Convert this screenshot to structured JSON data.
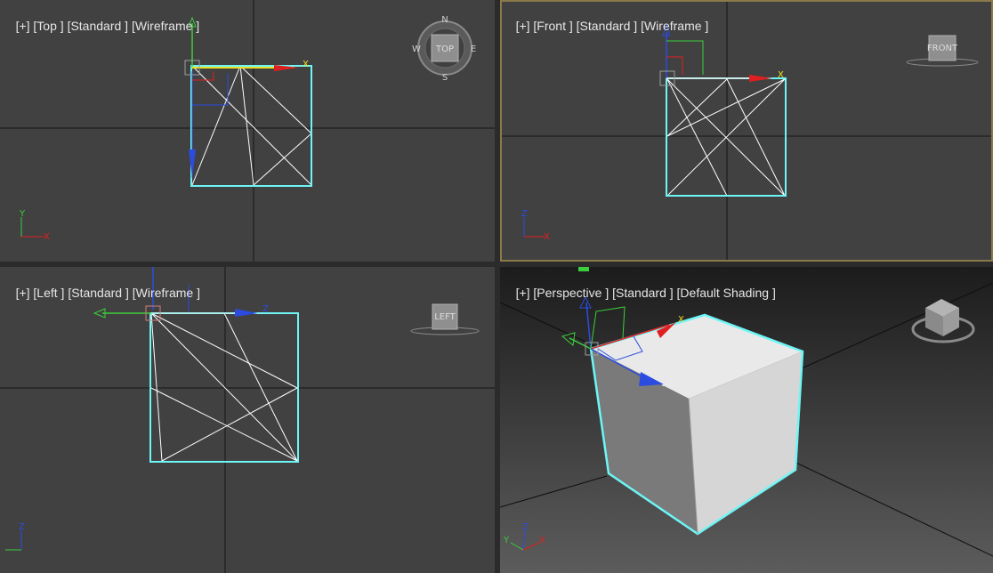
{
  "viewports": {
    "top": {
      "plus": "[+]",
      "view": "[Top ]",
      "std": "[Standard ]",
      "shade": "[Wireframe ]"
    },
    "front": {
      "plus": "[+]",
      "view": "[Front ]",
      "std": "[Standard ]",
      "shade": "[Wireframe ]"
    },
    "left": {
      "plus": "[+]",
      "view": "[Left ]",
      "std": "[Standard ]",
      "shade": "[Wireframe ]"
    },
    "persp": {
      "plus": "[+]",
      "view": "[Perspective ]",
      "std": "[Standard ]",
      "shade": "[Default Shading ]"
    }
  },
  "viewcube": {
    "top": {
      "face": "TOP",
      "n": "N",
      "s": "S",
      "e": "E",
      "w": "W"
    },
    "front": {
      "face": "FRONT"
    },
    "left": {
      "face": "LEFT"
    }
  },
  "axis_labels": {
    "x": "X",
    "y": "Y",
    "z": "Z"
  },
  "colors": {
    "selection": "#6ef5f5",
    "x_axis": "#e02020",
    "y_axis": "#3ccf3c",
    "z_axis": "#2c4ce0",
    "gizmo_active": "#f0e020",
    "active_viewport_border": "#8a7a4a"
  }
}
